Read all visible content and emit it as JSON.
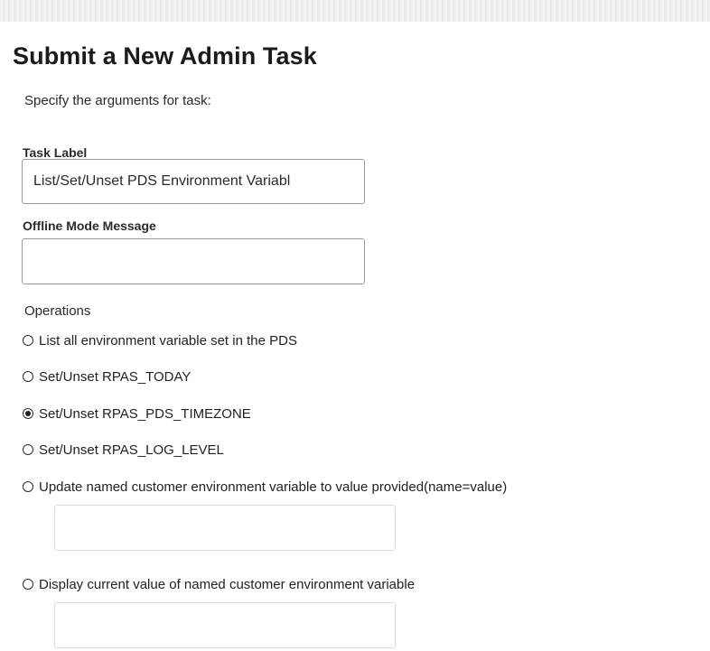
{
  "page": {
    "title": "Submit a New Admin Task",
    "intro": "Specify the arguments for task:"
  },
  "task_label": {
    "label": "Task Label",
    "value": "List/Set/Unset PDS Environment Variabl"
  },
  "offline_mode_message": {
    "label": "Offline Mode Message",
    "value": ""
  },
  "operations": {
    "label": "Operations",
    "selected_index": 2,
    "options": [
      {
        "label": "List all environment variable set in the PDS"
      },
      {
        "label": "Set/Unset RPAS_TODAY"
      },
      {
        "label": "Set/Unset RPAS_PDS_TIMEZONE"
      },
      {
        "label": "Set/Unset RPAS_LOG_LEVEL"
      },
      {
        "label": "Update named customer environment variable to value provided(name=value)",
        "input_value": ""
      },
      {
        "label": "Display current value of named customer environment variable",
        "input_value": ""
      }
    ]
  }
}
